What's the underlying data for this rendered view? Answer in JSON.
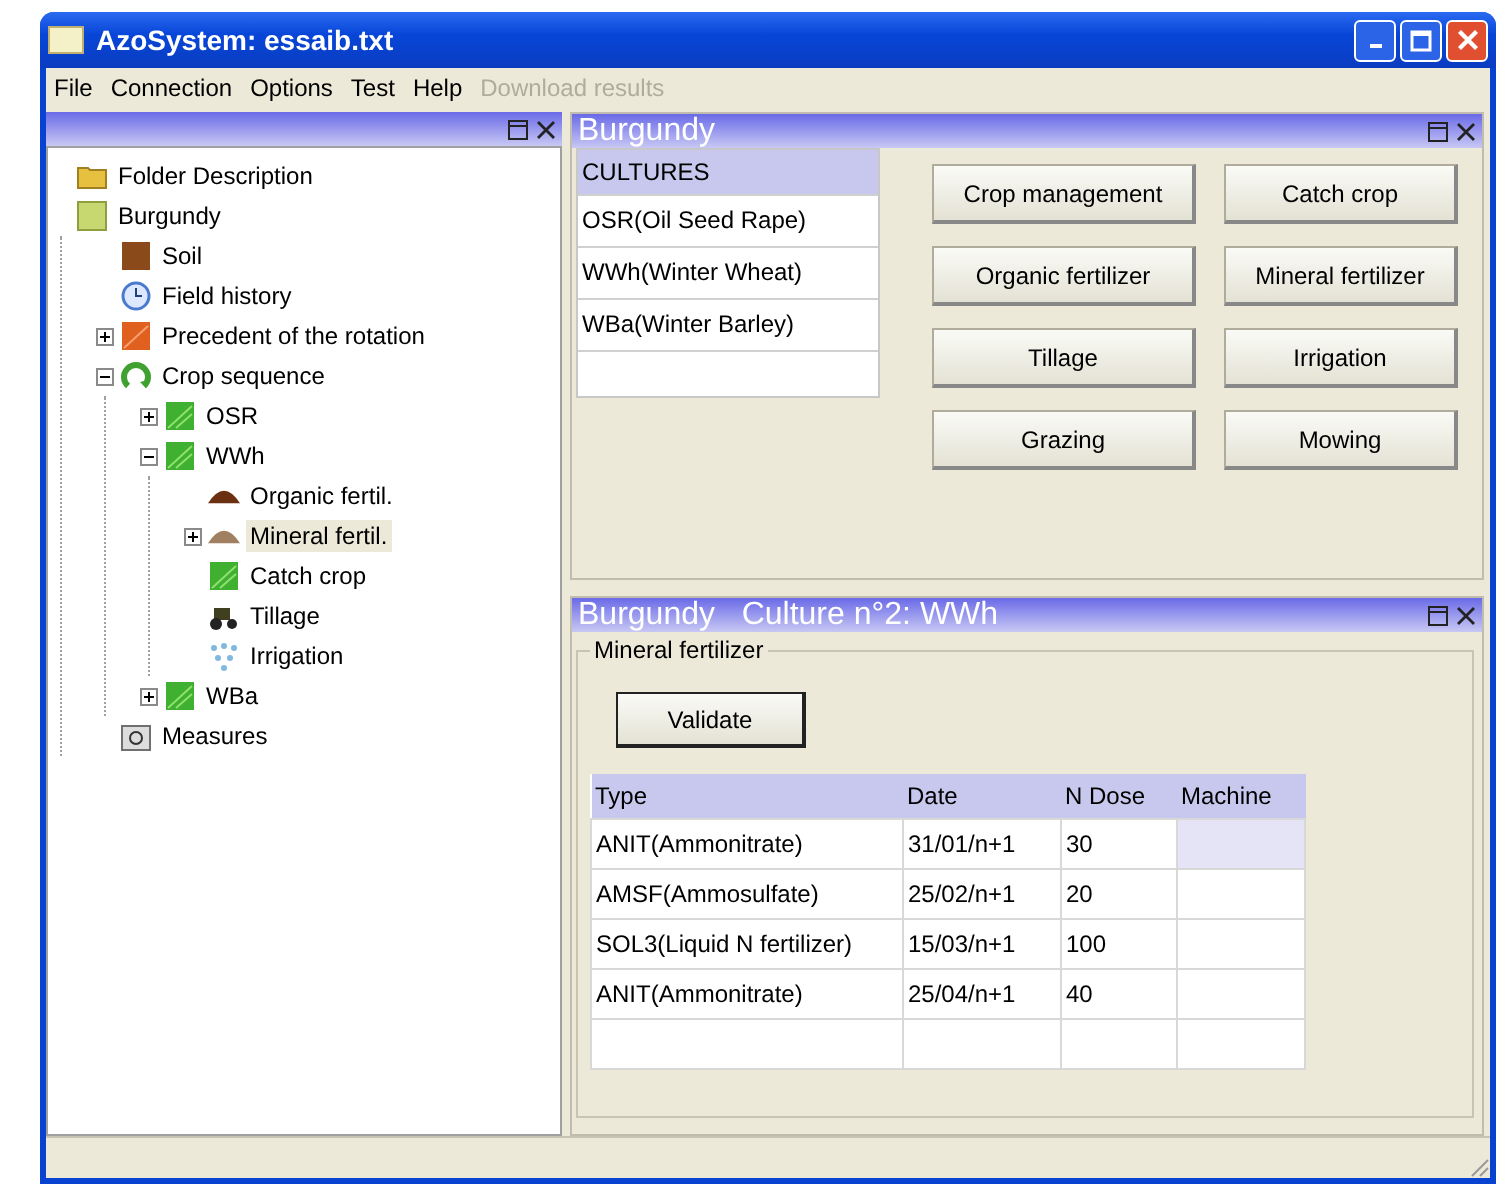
{
  "window": {
    "title": "AzoSystem: essaib.txt"
  },
  "menu": [
    {
      "label": "File",
      "disabled": false
    },
    {
      "label": "Connection",
      "disabled": false
    },
    {
      "label": "Options",
      "disabled": false
    },
    {
      "label": "Test",
      "disabled": false
    },
    {
      "label": "Help",
      "disabled": false
    },
    {
      "label": "Download results",
      "disabled": true
    }
  ],
  "tree": [
    {
      "label": "Folder Description",
      "kind": "folder",
      "selected": false
    },
    {
      "label": "Burgundy",
      "kind": "field",
      "selected": false,
      "children": [
        {
          "label": "Soil",
          "kind": "soil",
          "selected": false
        },
        {
          "label": "Field history",
          "kind": "history",
          "selected": false
        },
        {
          "label": "Precedent of the rotation",
          "kind": "precedent",
          "selected": false,
          "expanded": false
        },
        {
          "label": "Crop sequence",
          "kind": "sequence",
          "selected": false,
          "expanded": true,
          "children": [
            {
              "label": "OSR",
              "kind": "crop",
              "selected": false,
              "expanded": false
            },
            {
              "label": "WWh",
              "kind": "crop",
              "selected": false,
              "expanded": true,
              "children": [
                {
                  "label": "Organic fertil.",
                  "kind": "organic",
                  "selected": false
                },
                {
                  "label": "Mineral fertil.",
                  "kind": "mineral",
                  "selected": true,
                  "expanded": false
                },
                {
                  "label": "Catch crop",
                  "kind": "crop",
                  "selected": false
                },
                {
                  "label": "Tillage",
                  "kind": "tillage",
                  "selected": false
                },
                {
                  "label": "Irrigation",
                  "kind": "irrigation",
                  "selected": false
                }
              ]
            },
            {
              "label": "WBa",
              "kind": "crop",
              "selected": false,
              "expanded": false
            }
          ]
        },
        {
          "label": "Measures",
          "kind": "measures",
          "selected": false
        }
      ]
    }
  ],
  "top_panel": {
    "title": "Burgundy",
    "cultures_header": "CULTURES",
    "cultures": [
      {
        "label": "OSR(Oil Seed Rape)",
        "selected": false
      },
      {
        "label": "WWh(Winter Wheat)",
        "selected": false
      },
      {
        "label": "WBa(Winter Barley)",
        "selected": false
      }
    ],
    "buttons": [
      "Crop management",
      "Catch crop",
      "Organic fertilizer",
      "Mineral fertilizer",
      "Tillage",
      "Irrigation",
      "Grazing",
      "Mowing"
    ]
  },
  "bottom_panel": {
    "title": "Burgundy   Culture n°2: WWh",
    "group_label": "Mineral fertilizer",
    "validate_button": "Validate",
    "columns": [
      "Type",
      "Date",
      "N Dose",
      "Machine"
    ],
    "rows": [
      {
        "cells": [
          "ANIT(Ammonitrate)",
          "31/01/n+1",
          "30",
          ""
        ],
        "selected": true
      },
      {
        "cells": [
          "AMSF(Ammosulfate)",
          "25/02/n+1",
          "20",
          ""
        ],
        "selected": false
      },
      {
        "cells": [
          "SOL3(Liquid N fertilizer)",
          "15/03/n+1",
          "100",
          ""
        ],
        "selected": false
      },
      {
        "cells": [
          "ANIT(Ammonitrate)",
          "25/04/n+1",
          "40",
          ""
        ],
        "selected": false
      }
    ]
  }
}
